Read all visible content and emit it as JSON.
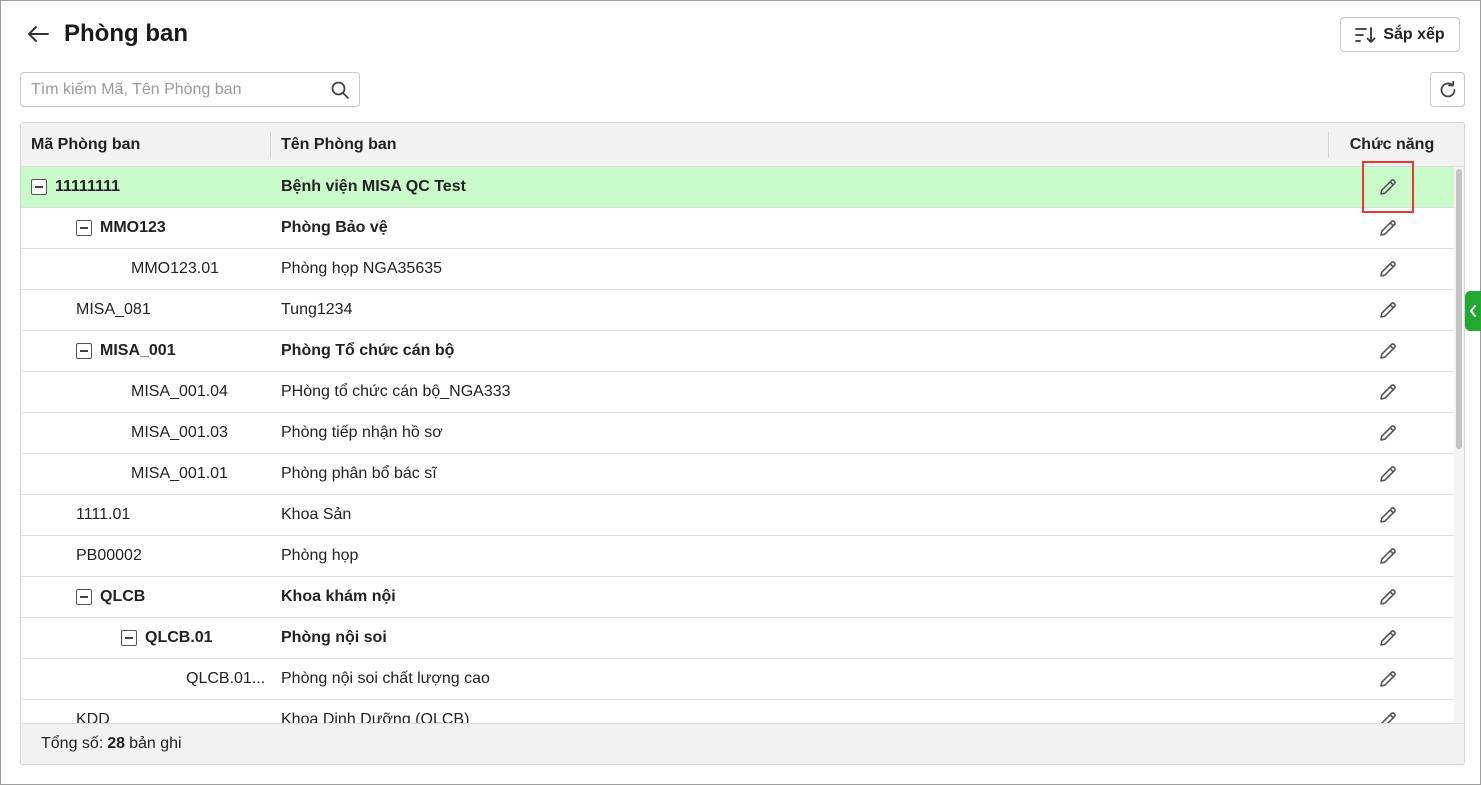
{
  "header": {
    "title": "Phòng ban",
    "sort_label": "Sắp xếp"
  },
  "search": {
    "placeholder": "Tìm kiếm Mã, Tên Phòng ban",
    "value": ""
  },
  "table": {
    "columns": {
      "code": "Mã Phòng ban",
      "name": "Tên Phòng ban",
      "function": "Chức năng"
    },
    "rows": [
      {
        "code": "11111111",
        "name": "Bệnh viện MISA QC Test",
        "level": 0,
        "expandable": true,
        "selected": true
      },
      {
        "code": "MMO123",
        "name": "Phòng Bảo vệ",
        "level": 1,
        "expandable": true
      },
      {
        "code": "MMO123.01",
        "name": "Phòng họp NGA35635",
        "level": 2,
        "expandable": false
      },
      {
        "code": "MISA_081",
        "name": "Tung1234",
        "level": 1,
        "expandable": false
      },
      {
        "code": "MISA_001",
        "name": "Phòng Tổ chức cán bộ",
        "level": 1,
        "expandable": true
      },
      {
        "code": "MISA_001.04",
        "name": "PHòng tổ chức cán bộ_NGA333",
        "level": 2,
        "expandable": false
      },
      {
        "code": "MISA_001.03",
        "name": "Phòng tiếp nhận hồ sơ",
        "level": 2,
        "expandable": false
      },
      {
        "code": "MISA_001.01",
        "name": "Phòng phân bổ bác sĩ",
        "level": 2,
        "expandable": false
      },
      {
        "code": "1111.01",
        "name": "Khoa Sản",
        "level": 1,
        "expandable": false
      },
      {
        "code": "PB00002",
        "name": "Phòng họp",
        "level": 1,
        "expandable": false
      },
      {
        "code": "QLCB",
        "name": "Khoa khám nội",
        "level": 1,
        "expandable": true
      },
      {
        "code": "QLCB.01",
        "name": "Phòng nội soi",
        "level": 2,
        "expandable": true
      },
      {
        "code": "QLCB.01...",
        "name": "Phòng nội soi chất lượng cao",
        "level": 3,
        "expandable": false
      },
      {
        "code": "KDD",
        "name": "Khoa Dinh Dưỡng (QLCB)",
        "level": 1,
        "expandable": false
      }
    ]
  },
  "footer": {
    "total_label": "Tổng số:",
    "total_count": "28",
    "total_suffix": "bản ghi"
  },
  "colors": {
    "selected_row": "#c9fbca",
    "highlight": "#e53935",
    "side_tab": "#22a832"
  },
  "icons": [
    "back-arrow-icon",
    "sort-icon",
    "search-icon",
    "refresh-icon",
    "edit-pencil-icon",
    "collapse-icon",
    "chevron-left-icon"
  ]
}
